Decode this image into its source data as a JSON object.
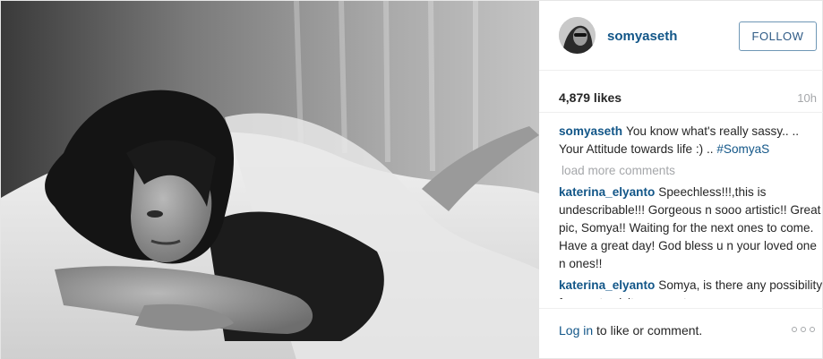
{
  "post": {
    "photo_icon": "photo",
    "header": {
      "avatar_icon": "avatar",
      "username": "somyaseth",
      "follow_label": "FOLLOW"
    },
    "stats": {
      "likes": "4,879 likes",
      "time": "10h"
    },
    "caption": {
      "user": "somyaseth",
      "text": "You know what's really sassy.. .. Your Attitude towards life :) ..",
      "hashtag": "#SomyaS"
    },
    "load_more": "load more comments",
    "comments": [
      {
        "user": "katerina_elyanto",
        "text": "Speechless!!!,this is undescribable!!! Gorgeous n sooo artistic!! Great pic, Somya!! Waiting for the next ones to come. Have a great day! God bless u n your loved one n ones!!"
      },
      {
        "user": "katerina_elyanto",
        "text": "Somya, is there any possibility for you to visit my country once"
      }
    ],
    "footer": {
      "login_link": "Log in",
      "login_rest": " to like or comment.",
      "more_icon": "more-options-icon"
    }
  }
}
